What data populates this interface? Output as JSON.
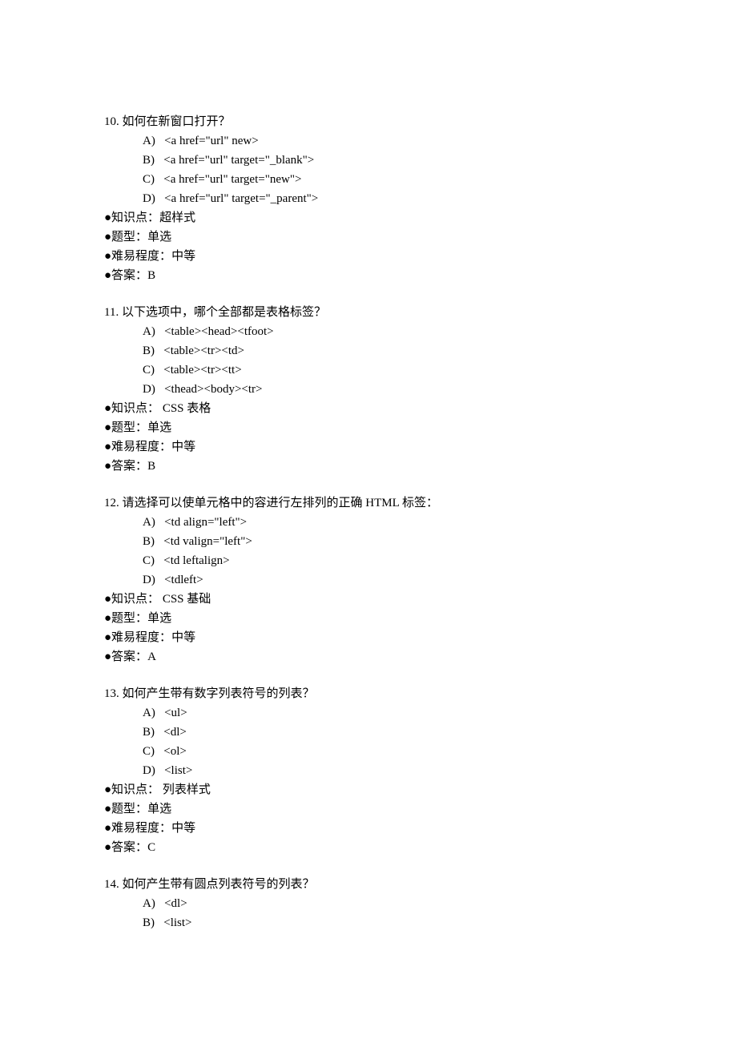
{
  "questions": [
    {
      "number": "10.",
      "stem": "如何在新窗口打开？",
      "options": [
        {
          "label": "A)",
          "text": "<a href=\"url\" new>"
        },
        {
          "label": "B)",
          "text": "<a href=\"url\" target=\"_blank\">"
        },
        {
          "label": "C)",
          "text": "<a href=\"url\" target=\"new\">"
        },
        {
          "label": "D)",
          "text": "<a href=\"url\" target=\"_parent\">"
        }
      ],
      "meta": {
        "kpoint_label": "●知识点：",
        "kpoint_value": "超样式",
        "type_label": "●题型：",
        "type_value": "单选",
        "diff_label": "●难易程度：",
        "diff_value": "中等",
        "ans_label": "●答案：",
        "ans_value": "B"
      }
    },
    {
      "number": "11.",
      "stem": "以下选项中，哪个全部都是表格标签？",
      "options": [
        {
          "label": "A)",
          "text": "<table><head><tfoot>"
        },
        {
          "label": "B)",
          "text": "<table><tr><td>"
        },
        {
          "label": "C)",
          "text": "<table><tr><tt>"
        },
        {
          "label": "D)",
          "text": "<thead><body><tr>"
        }
      ],
      "meta": {
        "kpoint_label": "●知识点：",
        "kpoint_value": " CSS 表格",
        "type_label": "●题型：",
        "type_value": "单选",
        "diff_label": "●难易程度：",
        "diff_value": "中等",
        "ans_label": "●答案：",
        "ans_value": "B"
      }
    },
    {
      "number": "12.",
      "stem": "请选择可以使单元格中的容进行左排列的正确 HTML 标签：",
      "options": [
        {
          "label": "A)",
          "text": "<td align=\"left\">"
        },
        {
          "label": "B)",
          "text": "<td valign=\"left\">"
        },
        {
          "label": "C)",
          "text": "<td leftalign>"
        },
        {
          "label": "D)",
          "text": "<tdleft>"
        }
      ],
      "meta": {
        "kpoint_label": "●知识点：",
        "kpoint_value": " CSS 基础",
        "type_label": "●题型：",
        "type_value": "单选",
        "diff_label": "●难易程度：",
        "diff_value": "中等",
        "ans_label": "●答案：",
        "ans_value": "A"
      }
    },
    {
      "number": "13.",
      "stem": "如何产生带有数字列表符号的列表？",
      "options": [
        {
          "label": "A)",
          "text": "<ul>"
        },
        {
          "label": "B)",
          "text": "<dl>"
        },
        {
          "label": "C)",
          "text": "<ol>"
        },
        {
          "label": "D)",
          "text": "<list>"
        }
      ],
      "meta": {
        "kpoint_label": "●知识点：",
        "kpoint_value": " 列表样式",
        "type_label": "●题型：",
        "type_value": "单选",
        "diff_label": "●难易程度：",
        "diff_value": "中等",
        "ans_label": "●答案：",
        "ans_value": "C"
      }
    },
    {
      "number": "14.",
      "stem": "如何产生带有圆点列表符号的列表？",
      "options": [
        {
          "label": "A)",
          "text": "<dl>"
        },
        {
          "label": "B)",
          "text": "<list>"
        }
      ],
      "meta": null
    }
  ]
}
